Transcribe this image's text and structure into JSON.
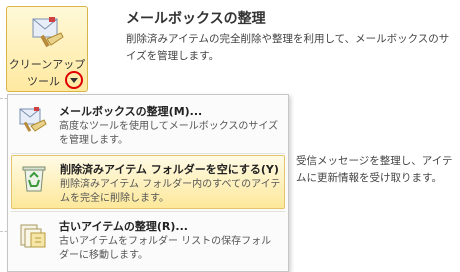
{
  "cleanup_button": {
    "label_line1": "クリーンアップ",
    "label_line2": "ツール"
  },
  "section": {
    "title": "メールボックスの整理",
    "description": "削除済みアイテムの完全削除や整理を利用して、メールボックスのサイズを管理します。"
  },
  "background_text": "受信メッセージを整理し、アイテムに更新情報を受け取ります。",
  "menu": {
    "items": [
      {
        "title": "メールボックスの整理(M)...",
        "description": "高度なツールを使用してメールボックスのサイズを管理します。",
        "icon": "mailbox-cleanup-icon",
        "highlighted": false
      },
      {
        "title": "削除済みアイテム フォルダーを空にする(Y)",
        "description": "削除済みアイテム フォルダー内のすべてのアイテムを完全に削除します。",
        "icon": "recycle-bin-icon",
        "highlighted": true
      },
      {
        "title": "古いアイテムの整理(R)...",
        "description": "古いアイテムをフォルダー リストの保存フォルダーに移動します。",
        "icon": "archive-icon",
        "highlighted": false
      }
    ]
  },
  "colors": {
    "highlight_bg": "#fde89a",
    "highlight_border": "#e4c46b",
    "callout_circle": "#e00000"
  }
}
